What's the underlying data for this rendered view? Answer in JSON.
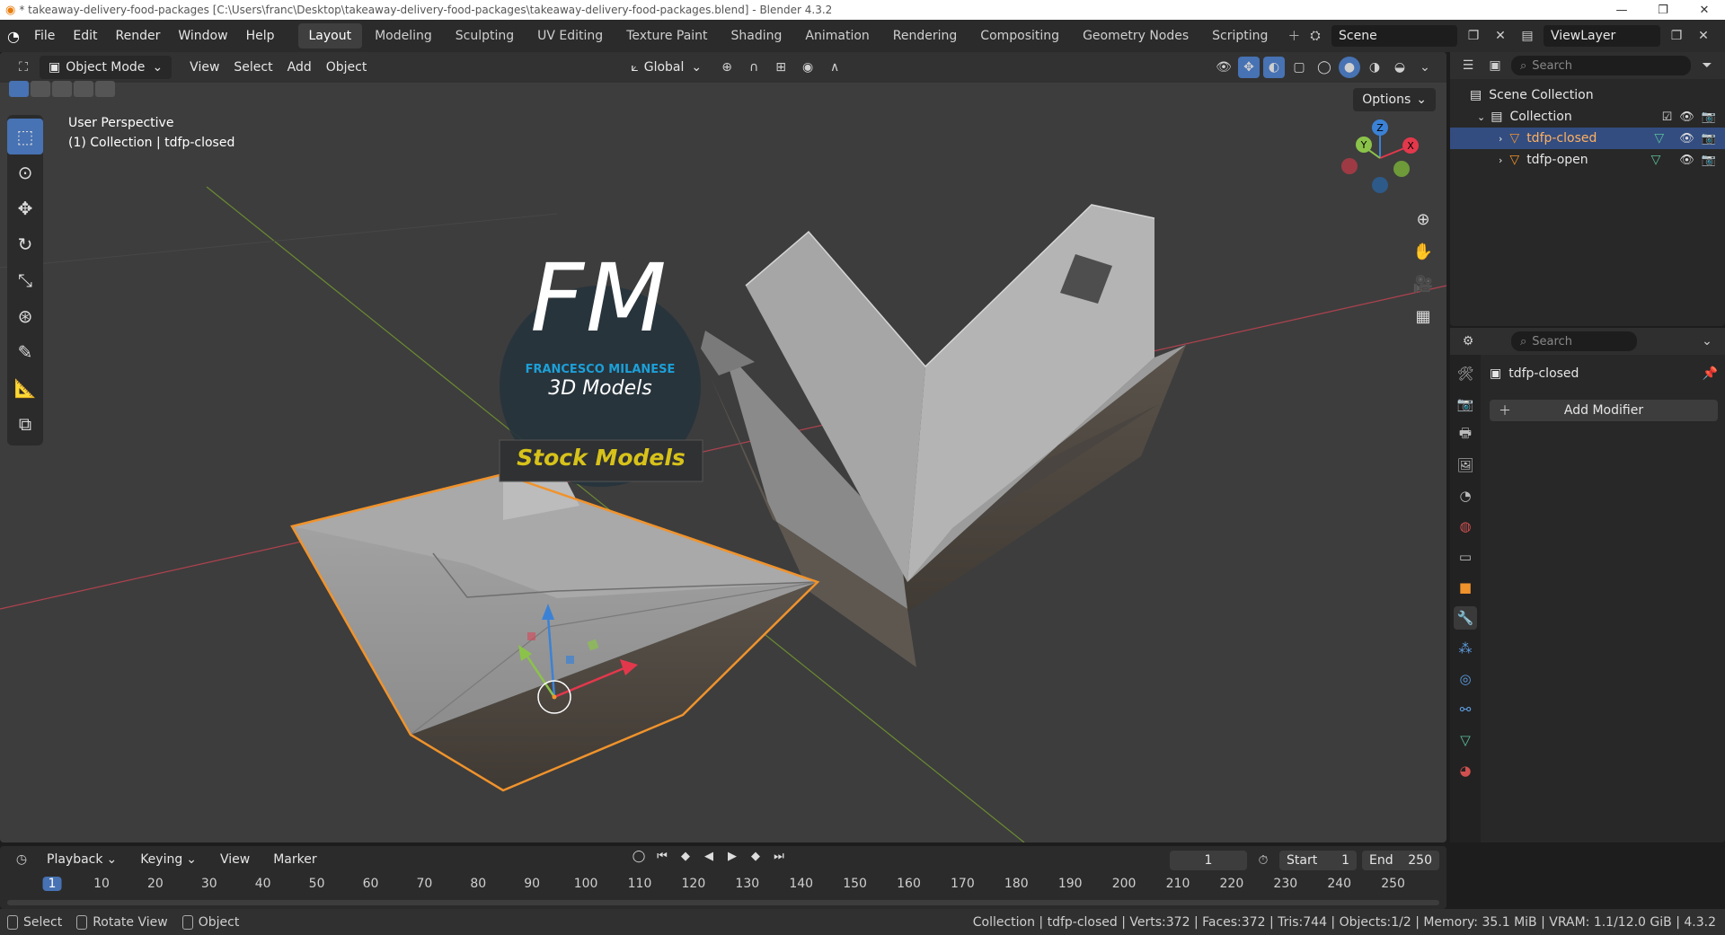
{
  "window": {
    "title": "* takeaway-delivery-food-packages [C:\\Users\\franc\\Desktop\\takeaway-delivery-food-packages\\takeaway-delivery-food-packages.blend] - Blender 4.3.2"
  },
  "menu": [
    "File",
    "Edit",
    "Render",
    "Window",
    "Help"
  ],
  "workspaces": [
    "Layout",
    "Modeling",
    "Sculpting",
    "UV Editing",
    "Texture Paint",
    "Shading",
    "Animation",
    "Rendering",
    "Compositing",
    "Geometry Nodes",
    "Scripting"
  ],
  "active_workspace": "Layout",
  "scene": {
    "name": "Scene",
    "view_layer": "ViewLayer"
  },
  "viewport": {
    "mode": "Object Mode",
    "menus": [
      "View",
      "Select",
      "Add",
      "Object"
    ],
    "orientation": "Global",
    "options": "Options",
    "info_line1": "User Perspective",
    "info_line2": "(1) Collection | tdfp-closed",
    "watermark": {
      "logo": "FM",
      "name": "FRANCESCO MILANESE",
      "sub": "3D Models",
      "badge": "Stock Models"
    },
    "gizmo_axes": [
      "X",
      "Y",
      "Z"
    ]
  },
  "outliner": {
    "search_placeholder": "Search",
    "root": "Scene Collection",
    "collection": "Collection",
    "objects": [
      {
        "name": "tdfp-closed",
        "selected": true
      },
      {
        "name": "tdfp-open",
        "selected": false
      }
    ]
  },
  "properties": {
    "search_placeholder": "Search",
    "object": "tdfp-closed",
    "add_modifier": "Add Modifier"
  },
  "timeline": {
    "menus": [
      "Playback",
      "Keying",
      "View",
      "Marker"
    ],
    "current_frame": "1",
    "start_label": "Start",
    "start": "1",
    "end_label": "End",
    "end": "250",
    "ruler": [
      "1",
      "10",
      "20",
      "30",
      "40",
      "50",
      "60",
      "70",
      "80",
      "90",
      "100",
      "110",
      "120",
      "130",
      "140",
      "150",
      "160",
      "170",
      "180",
      "190",
      "200",
      "210",
      "220",
      "230",
      "240",
      "250"
    ]
  },
  "statusbar": {
    "hints": [
      "Select",
      "Rotate View",
      "Object"
    ],
    "stats": "Collection | tdfp-closed | Verts:372 | Faces:372 | Tris:744 | Objects:1/2 | Memory: 35.1 MiB | VRAM: 1.1/12.0 GiB | 4.3.2"
  },
  "colors": {
    "selection_outline": "#f0932c",
    "accent": "#4772b3",
    "x_axis": "#e3384c",
    "y_axis": "#8bc34a",
    "z_axis": "#3b82d6",
    "watermark_blue": "#1ca0d8",
    "watermark_yellow": "#d7c21a"
  }
}
